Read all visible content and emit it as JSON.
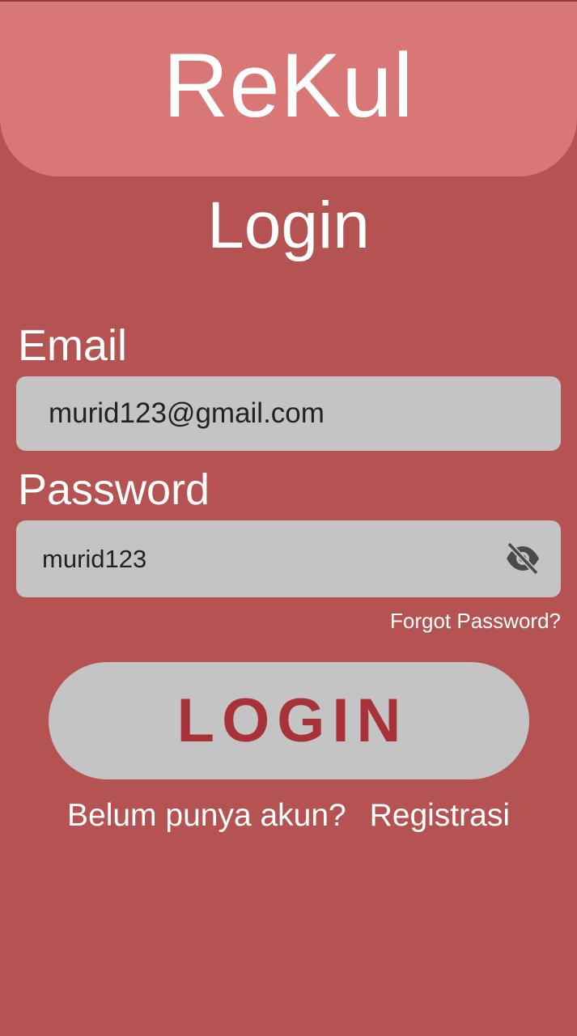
{
  "header": {
    "app_title": "ReKul"
  },
  "page_title": "Login",
  "email": {
    "label": "Email",
    "value": "murid123@gmail.com"
  },
  "password": {
    "label": "Password",
    "value": "murid123",
    "toggle_icon": "eye-off-icon"
  },
  "forgot_password": "Forgot Password?",
  "login_button": "LOGIN",
  "register": {
    "prompt": "Belum punya akun?",
    "link": "Registrasi"
  },
  "colors": {
    "background": "#b55252",
    "header": "#d97676",
    "input": "#c4c4c4",
    "button_text": "#a8323a"
  }
}
